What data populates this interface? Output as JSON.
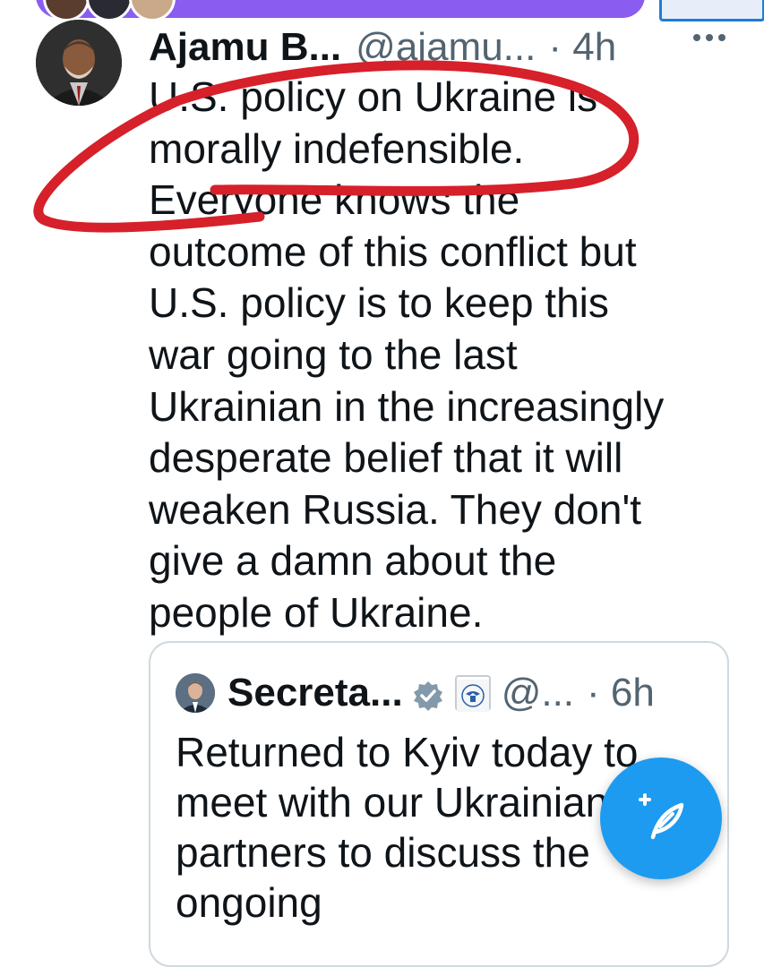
{
  "tweet": {
    "author_name": "Ajamu B...",
    "author_handle": "@ajamu...",
    "time": "· 4h",
    "more_icon": "more-horizontal-icon",
    "lines": [
      "U.S. policy on Ukraine is",
      "morally indefensible.",
      "Everyone knows the",
      "outcome of this conflict but",
      "U.S. policy is to keep this",
      "war going to the last",
      "Ukrainian in the increasingly",
      "desperate belief that it will",
      "weaken Russia. They don't",
      "give a damn about the",
      "people of Ukraine."
    ]
  },
  "quoted_tweet": {
    "author_name": "Secreta...",
    "author_handle": "@...",
    "time": "· 6h",
    "verified_badge": "gray-government-badge",
    "affiliation_icon": "us-state-department-seal-icon",
    "lines": [
      "Returned to Kyiv today to",
      "meet with our Ukrainian",
      "partners to discuss the",
      "ongoing"
    ]
  },
  "compose_button": {
    "icon": "compose-feather-plus-icon"
  },
  "annotation": {
    "color": "#d6202a"
  },
  "colors": {
    "text_primary": "#0f1419",
    "text_secondary": "#536471",
    "accent_blue": "#1d9bf0",
    "border": "#cfd9de",
    "top_bar_purple": "#8a5cf0"
  }
}
